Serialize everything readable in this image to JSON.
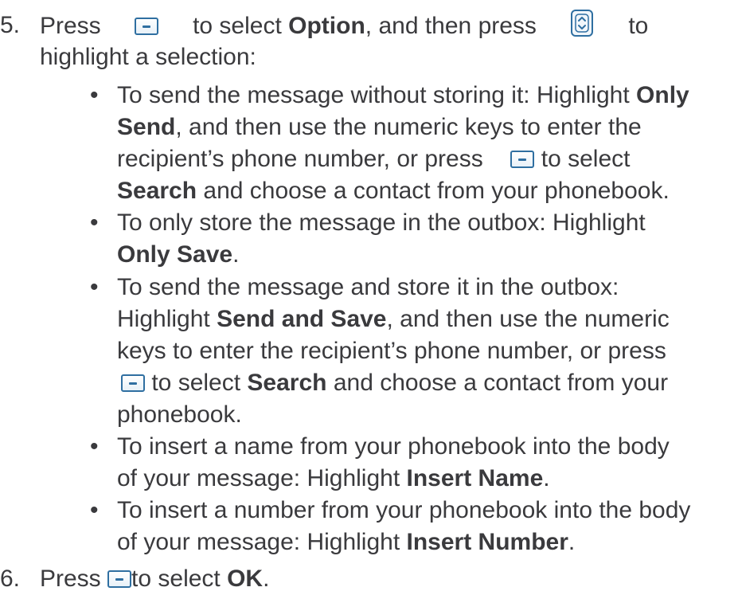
{
  "step5": {
    "number": "5.",
    "l1_a": "Press",
    "l1_b": "to select",
    "l1_option": "Option",
    "l1_c": ", and then press",
    "l1_d": "to",
    "l2": "highlight a selection:"
  },
  "bullets": {
    "symbol": "•",
    "b1_l1_a": "To send the message without storing it: Highlight ",
    "b1_l1_b": "Only",
    "b1_l2_a": "Send",
    "b1_l2_b": ", and then use the numeric keys to enter the",
    "b1_l3_a": "recipient’s phone number, or press",
    "b1_l3_b": "to select",
    "b1_l4_a": "Search",
    "b1_l4_b": " and choose a contact from your phonebook.",
    "b2_l1": "To only store the message in the outbox: Highlight",
    "b2_l2_a": "Only Save",
    "b2_l2_b": ".",
    "b3_l1": "To send the message and store it in the outbox:",
    "b3_l2_a": "Highlight ",
    "b3_l2_b": "Send and Save",
    "b3_l2_c": ", and then use the numeric",
    "b3_l3": "keys to enter the recipient’s phone number, or press",
    "b3_l4_a": " to select ",
    "b3_l4_b": "Search",
    "b3_l4_c": " and choose a contact from your",
    "b3_l5": "phonebook.",
    "b4_l1": "To insert a name from your phonebook into the body",
    "b4_l2_a": "of your message: Highlight ",
    "b4_l2_b": "Insert Name",
    "b4_l2_c": ".",
    "b5_l1": "To insert a number from your phonebook into the body",
    "b5_l2_a": "of your message: Highlight ",
    "b5_l2_b": "Insert Number",
    "b5_l2_c": "."
  },
  "step6": {
    "number": "6.",
    "a": "Press",
    "b": "to select ",
    "ok": "OK",
    "c": "."
  },
  "icons": {
    "softkey": "softkey-minus-icon",
    "nav": "nav-up-down-icon",
    "accent": "#2f6fa1",
    "text": "#3a3a3d"
  }
}
